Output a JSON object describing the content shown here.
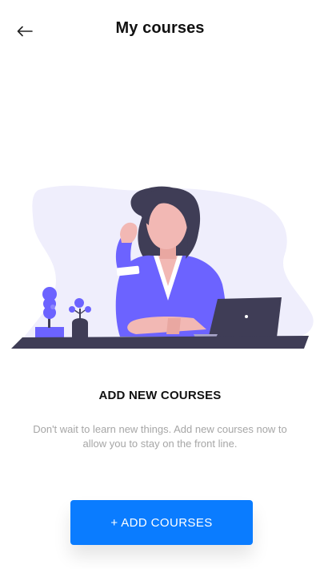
{
  "header": {
    "title": "My courses",
    "back_icon": "arrow-left-icon"
  },
  "illustration": {
    "icon": "woman-at-desk-illustration",
    "colors": {
      "blob": "#efeefc",
      "accent": "#6c63ff",
      "hair": "#3f3d56",
      "skin": "#f2b8b4",
      "desk": "#3f3d56",
      "laptop": "#3f3d56"
    }
  },
  "empty_state": {
    "title": "ADD NEW COURSES",
    "description": "Don't wait to learn new things. Add new courses now to allow you to stay on the front line."
  },
  "actions": {
    "add_courses_label": "+ ADD COURSES"
  },
  "colors": {
    "primary": "#0a7cff",
    "text": "#111111",
    "muted": "#a6a6a6",
    "background": "#ffffff"
  }
}
